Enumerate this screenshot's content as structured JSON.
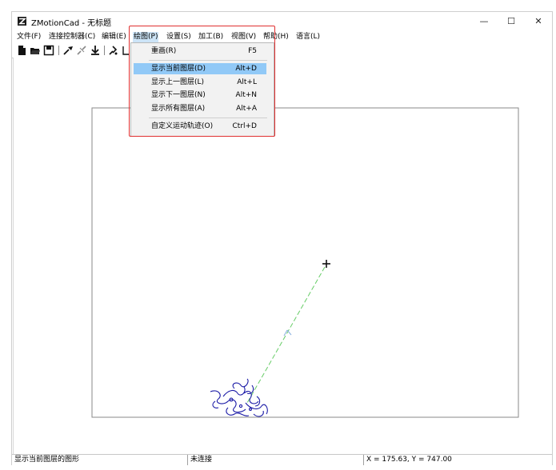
{
  "window": {
    "title": "ZMotionCad - 无标题",
    "minimize_glyph": "—",
    "maximize_glyph": "☐",
    "close_glyph": "✕"
  },
  "menubar": {
    "items": [
      "文件(F)",
      "连接控制器(C)",
      "编辑(E)",
      "绘图(P)",
      "设置(S)",
      "加工(B)",
      "视图(V)",
      "帮助(H)",
      "语言(L)"
    ]
  },
  "toolbar": {
    "icons": [
      "new-file-icon",
      "open-folder-icon",
      "save-icon",
      "connect-icon",
      "disconnect-icon",
      "download-icon",
      "align-icon",
      "line-icon"
    ]
  },
  "dropdown": {
    "items": [
      {
        "label": "重画(R)",
        "shortcut": "F5"
      },
      {
        "label": "显示当前图层(D)",
        "shortcut": "Alt+D"
      },
      {
        "label": "显示上一图层(L)",
        "shortcut": "Alt+L"
      },
      {
        "label": "显示下一图层(N)",
        "shortcut": "Alt+N"
      },
      {
        "label": "显示所有图层(A)",
        "shortcut": "Alt+A"
      },
      {
        "label": "自定义运动轨迹(O)",
        "shortcut": "Ctrl+D"
      }
    ]
  },
  "statusbar": {
    "message": "显示当前图层的图形",
    "connection": "未连接",
    "coords": "X = 175.63, Y = 747.00"
  },
  "colors": {
    "highlight_box": "#e03030",
    "menu_hover": "#91c9f7",
    "path_line": "#66cc66",
    "drawing": "#1a1aa6"
  }
}
